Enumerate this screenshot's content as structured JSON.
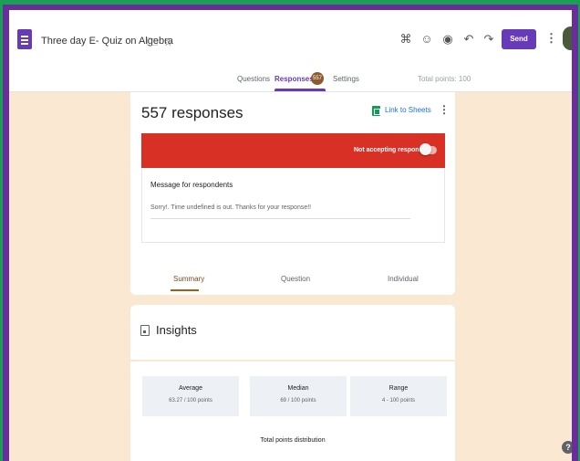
{
  "colors": {
    "outer_frame": "#1aa055",
    "inner_frame": "#6a2d9c",
    "page_bg": "#fbe8d3",
    "accent": "#673ab7",
    "banner": "#d93025",
    "sheets": "#0f9d58"
  },
  "header": {
    "form_icon": "forms-doc-icon",
    "title": "Three day E- Quiz on Algebra",
    "title_icons": [
      "folder-icon",
      "star-icon"
    ],
    "toolbar_icons": [
      "addon-puzzle-icon",
      "palette-icon",
      "eye-preview-icon",
      "undo-icon",
      "redo-icon"
    ],
    "send_label": "Send",
    "more_icon": "more-vert-icon"
  },
  "tabs": {
    "questions": "Questions",
    "responses": "Responses",
    "responses_badge": "557",
    "settings": "Settings",
    "total_points": "Total points: 100"
  },
  "responses_card": {
    "count_label": "557 responses",
    "sheets_link": "Link to Sheets",
    "not_accepting": "Not accepting responses",
    "accepting_toggle_on": false,
    "message_label": "Message for respondents",
    "message_text": "Sorry!. Time undefined is out. Thanks for your response!!",
    "sub_tabs": [
      "Summary",
      "Question",
      "Individual"
    ],
    "active_sub_tab": "Summary"
  },
  "insights": {
    "title": "Insights",
    "stats": [
      {
        "label": "Average",
        "value": "63.27 / 100 points"
      },
      {
        "label": "Median",
        "value": "69 / 100 points"
      },
      {
        "label": "Range",
        "value": "4 - 100 points"
      }
    ],
    "distribution_title": "Total points distribution"
  },
  "help_label": "?"
}
